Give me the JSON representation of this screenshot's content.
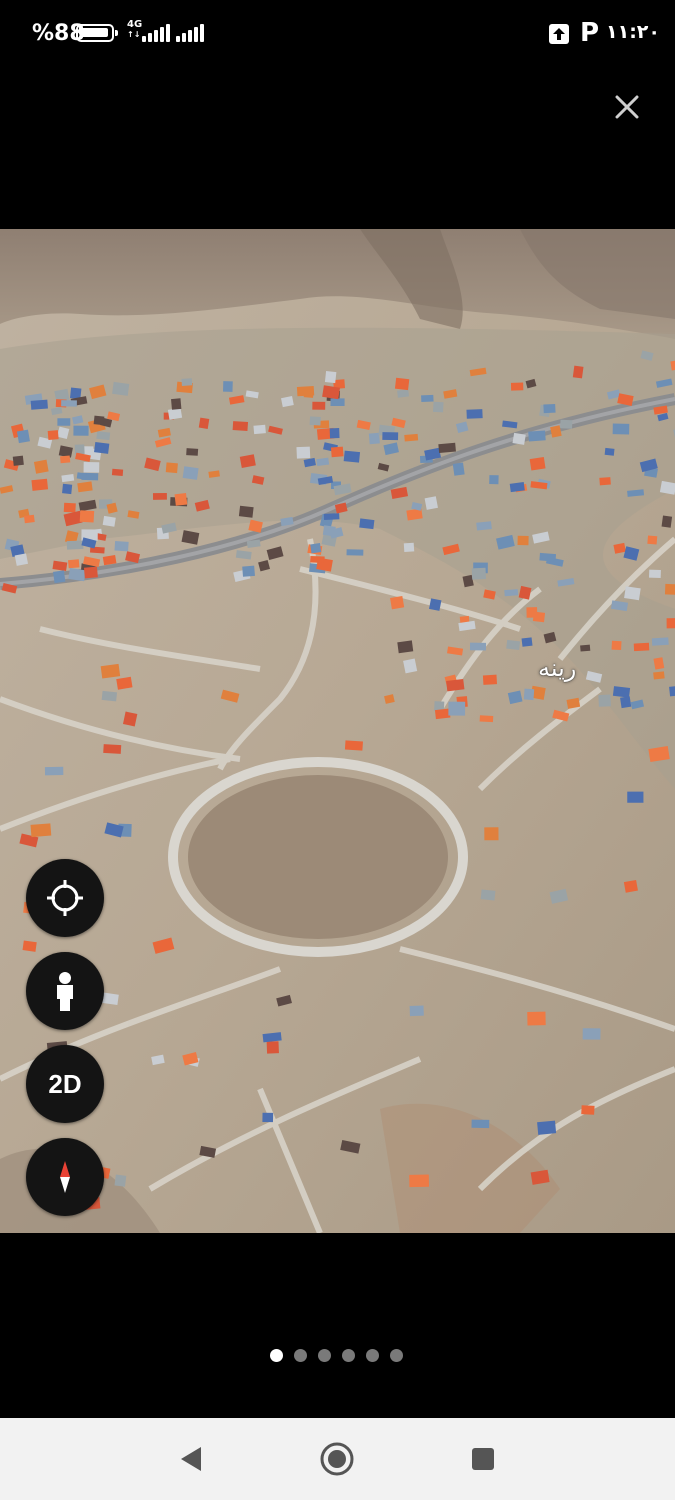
{
  "status_bar": {
    "battery_text": "%88",
    "network_type": "4G",
    "time": "۱۱:۲۰"
  },
  "viewer": {
    "close_icon": "close-icon",
    "place_label": "رینه",
    "page_count": 6,
    "active_page": 1
  },
  "map_controls": {
    "locate_icon": "crosshair-icon",
    "street_view_icon": "pegman-icon",
    "mode_label": "2D",
    "compass_icon": "compass-icon"
  },
  "colors": {
    "background": "#000000",
    "nav_bar": "#f2f2f2",
    "control_bg": "#141414",
    "roof_orange": "#e9673a",
    "terrain": "#b8a996"
  },
  "nav_bar": {
    "back_icon": "back-triangle-icon",
    "home_icon": "home-circle-icon",
    "recents_icon": "recents-square-icon"
  }
}
